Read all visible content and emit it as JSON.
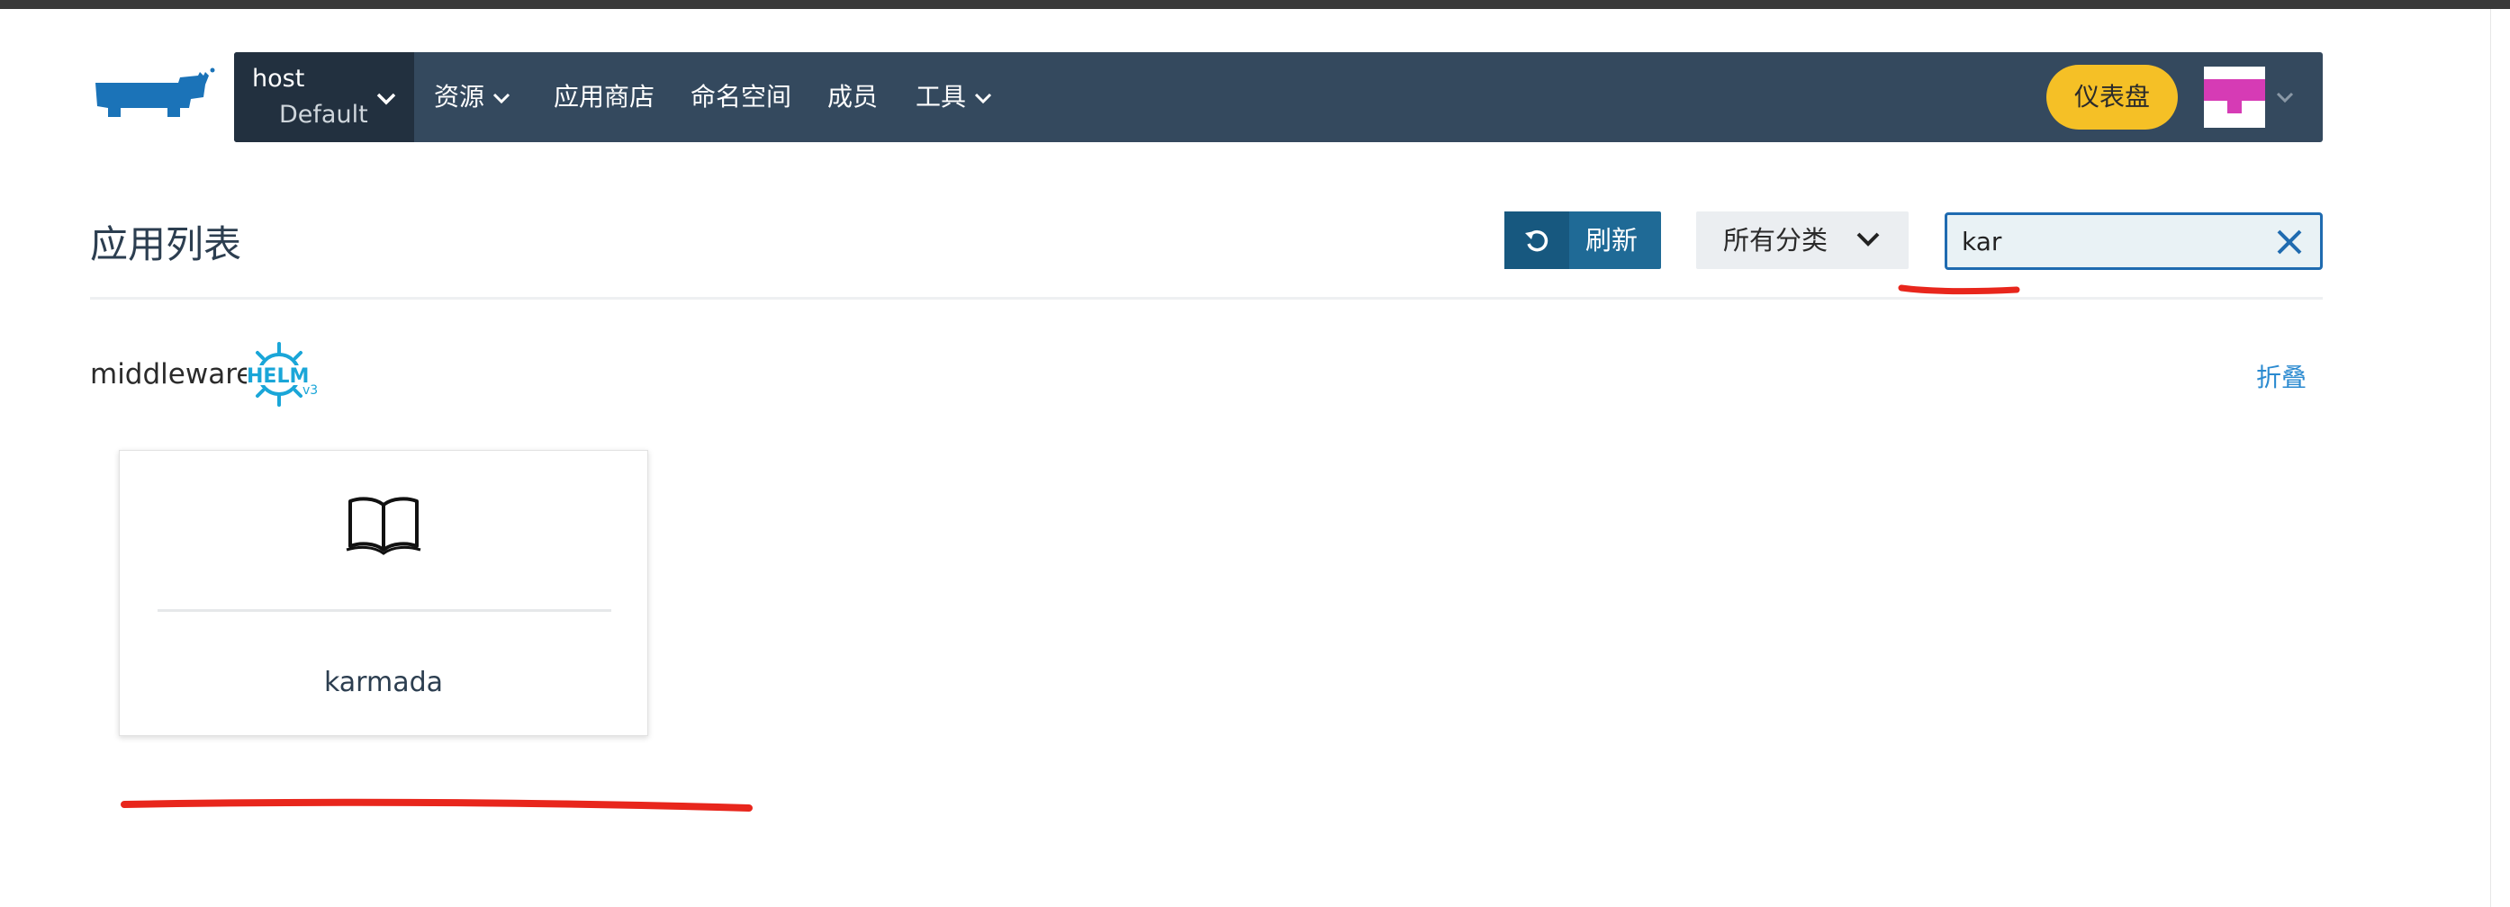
{
  "header": {
    "cluster": {
      "name": "host",
      "project": "Default"
    },
    "nav": [
      {
        "label": "资源",
        "dropdown": true
      },
      {
        "label": "应用商店",
        "dropdown": false
      },
      {
        "label": "命名空间",
        "dropdown": false
      },
      {
        "label": "成员",
        "dropdown": false
      },
      {
        "label": "工具",
        "dropdown": true
      }
    ],
    "dashboard_label": "仪表盘",
    "icons": {
      "logo": "rancher-logo",
      "avatar": "user-avatar-icon"
    }
  },
  "page": {
    "title": "应用列表",
    "refresh_label": "刷新",
    "category_label": "所有分类",
    "search": {
      "value": "kar",
      "placeholder": ""
    }
  },
  "catalog": {
    "name": "middleware",
    "badge": "HELM",
    "badge_version": "v3",
    "collapse_label": "折叠",
    "apps": [
      {
        "name": "karmada",
        "icon": "book-icon"
      }
    ]
  },
  "colors": {
    "navbar": "#34495e",
    "navbar_cluster": "#22303f",
    "dashboard_button": "#f5c026",
    "refresh_button": "#1f6a96",
    "search_border": "#1f6bb0",
    "link": "#2b8ad0",
    "annotation": "#e8261c"
  }
}
